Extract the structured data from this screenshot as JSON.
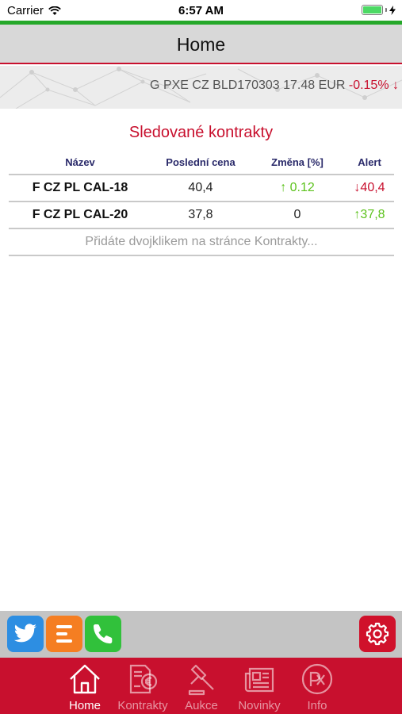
{
  "status_bar": {
    "carrier": "Carrier",
    "time": "6:57 AM"
  },
  "nav": {
    "title": "Home"
  },
  "ticker": {
    "text": "G PXE CZ BLD170303 17.48 EUR",
    "change": "-0.15% ↓"
  },
  "watchlist": {
    "title": "Sledované kontrakty",
    "columns": [
      "Název",
      "Poslední cena",
      "Změna [%]",
      "Alert"
    ],
    "rows": [
      {
        "name": "F CZ PL CAL-18",
        "price": "40,4",
        "change": "↑ 0.12",
        "alert": "↓40,4"
      },
      {
        "name": "F CZ PL CAL-20",
        "price": "37,8",
        "change": "0",
        "alert": "↑37,8"
      }
    ],
    "hint": "Přidáte dvojklikem na stránce Kontrakty..."
  },
  "tools": {
    "icons": [
      "twitter-icon",
      "list-e-icon",
      "phone-icon",
      "gear-icon"
    ]
  },
  "tabs": [
    {
      "label": "Home",
      "icon": "home-icon"
    },
    {
      "label": "Kontrakty",
      "icon": "contract-euro-icon"
    },
    {
      "label": "Aukce",
      "icon": "gavel-icon"
    },
    {
      "label": "Novinky",
      "icon": "newspaper-icon"
    },
    {
      "label": "Info",
      "icon": "info-logo-icon"
    }
  ],
  "colors": {
    "accent": "#c8102e",
    "up": "#5cc21c",
    "status_green": "#25a829"
  }
}
